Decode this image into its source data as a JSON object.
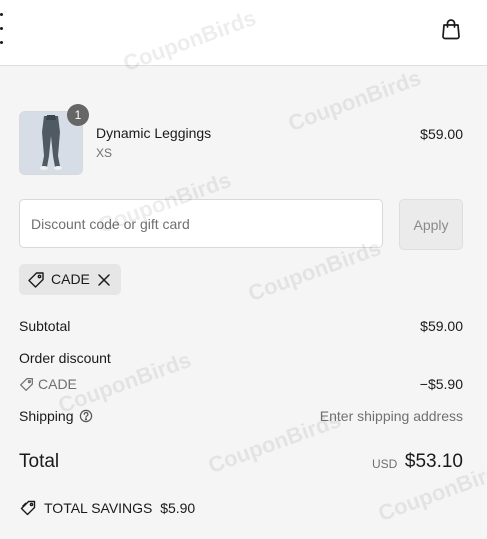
{
  "header": {
    "menu_icon": "vertical-dots-icon",
    "cart_icon": "shopping-bag-icon"
  },
  "line_item": {
    "title": "Dynamic Leggings",
    "variant": "XS",
    "price": "$59.00",
    "quantity": "1"
  },
  "discount": {
    "placeholder": "Discount code or gift card",
    "value": "",
    "apply_label": "Apply",
    "applied_code": "CADE"
  },
  "summary": {
    "subtotal_label": "Subtotal",
    "subtotal_value": "$59.00",
    "order_discount_label": "Order discount",
    "discount_code": "CADE",
    "discount_value": "−$5.90",
    "shipping_label": "Shipping",
    "shipping_value": "Enter shipping address",
    "total_label": "Total",
    "currency": "USD",
    "total_value": "$53.10",
    "savings_label": "TOTAL SAVINGS",
    "savings_value": "$5.90"
  },
  "watermark": "CouponBirds",
  "colors": {
    "background": "#f5f5f5",
    "text": "#1a1a1a",
    "muted": "#707070",
    "border": "#d9d9d9",
    "tag_bg": "#e6e6e6"
  }
}
